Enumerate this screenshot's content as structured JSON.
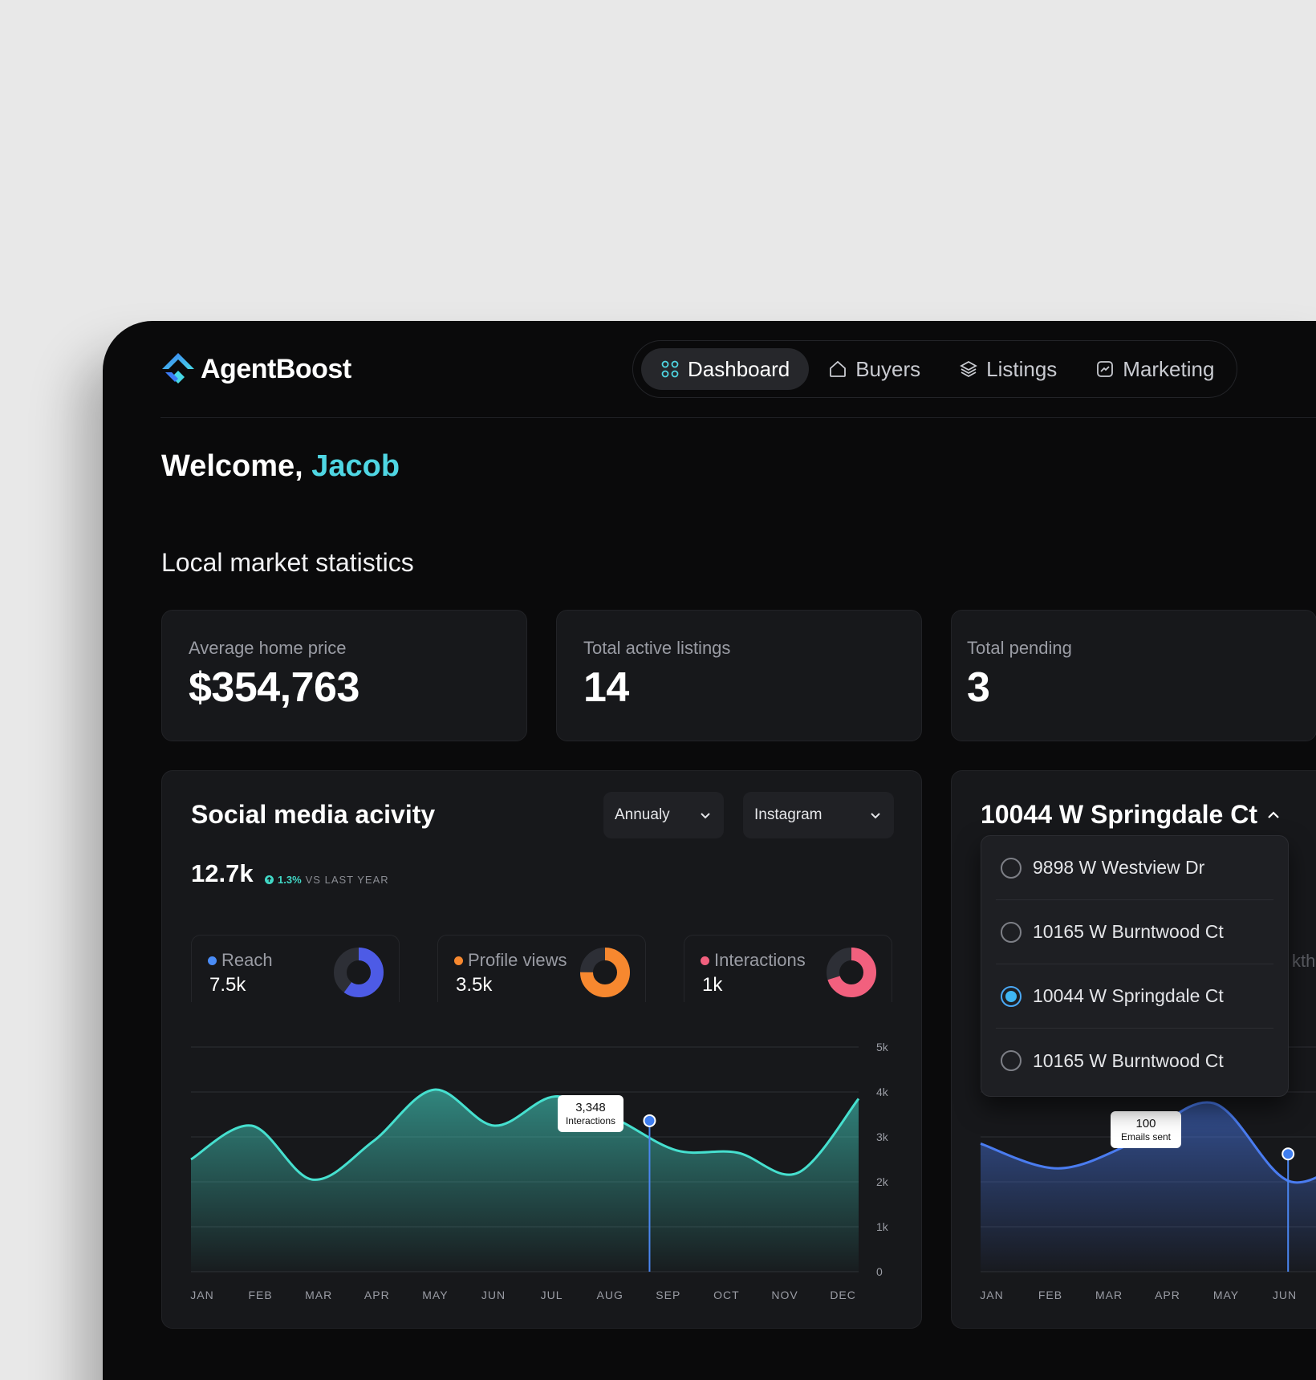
{
  "app": {
    "name": "AgentBoost",
    "accent": "#4fd6e3"
  },
  "nav": [
    {
      "label": "Dashboard",
      "icon": "grid-icon",
      "active": true
    },
    {
      "label": "Buyers",
      "icon": "home-icon",
      "active": false
    },
    {
      "label": "Listings",
      "icon": "layers-icon",
      "active": false
    },
    {
      "label": "Marketing",
      "icon": "trend-chart-icon",
      "active": false
    }
  ],
  "welcome": {
    "prefix": "Welcome, ",
    "name": "Jacob"
  },
  "section_title": "Local market statistics",
  "stats": [
    {
      "label": "Average home price",
      "value": "$354,763"
    },
    {
      "label": "Total active listings",
      "value": "14"
    },
    {
      "label": "Total pending",
      "value": "3"
    }
  ],
  "social": {
    "title": "Social media acivity",
    "period": "Annualy",
    "platform": "Instagram",
    "total": "12.7k",
    "delta": "1.3%",
    "delta_label": "VS LAST YEAR",
    "metrics": [
      {
        "label": "Reach",
        "value": "7.5k",
        "color": "#4a8cf7",
        "ring": "#4d5be6",
        "fraction": 0.6
      },
      {
        "label": "Profile views",
        "value": "3.5k",
        "color": "#f7882f",
        "ring": "#f7882f",
        "fraction": 0.75
      },
      {
        "label": "Interactions",
        "value": "1k",
        "color": "#f2607e",
        "ring": "#f2607e",
        "fraction": 0.7
      }
    ],
    "tooltip": {
      "value": "3,348",
      "label": "Interactions"
    }
  },
  "listing": {
    "title": "10044 W Springdale Ct",
    "options": [
      {
        "label": "9898 W Westview Dr",
        "selected": false
      },
      {
        "label": "10165 W Burntwood Ct",
        "selected": false
      },
      {
        "label": "10044 W Springdale Ct",
        "selected": true
      },
      {
        "label": "10165 W Burntwood Ct",
        "selected": false
      }
    ],
    "peek_text": "kthr",
    "tooltip": {
      "value": "100",
      "label": "Emails sent"
    }
  },
  "chart_data": [
    {
      "type": "area",
      "title": "Social media acivity",
      "categories": [
        "JAN",
        "FEB",
        "MAR",
        "APR",
        "MAY",
        "JUN",
        "JUL",
        "AUG",
        "SEP",
        "OCT",
        "NOV",
        "DEC"
      ],
      "yticks": [
        "0",
        "1k",
        "2k",
        "3k",
        "4k",
        "5k"
      ],
      "ylim": [
        0,
        5000
      ],
      "series": [
        {
          "name": "Interactions",
          "values": [
            2500,
            3250,
            2050,
            2900,
            4050,
            3250,
            3900,
            3400,
            2700,
            2650,
            2200,
            3850
          ]
        }
      ],
      "highlight": {
        "category": "AUG",
        "value": 3348
      },
      "color": "#46e0cf",
      "grid": true
    },
    {
      "type": "area",
      "title": "10044 W Springdale Ct",
      "categories": [
        "JAN",
        "FEB",
        "MAR",
        "APR",
        "MAY",
        "JUN"
      ],
      "ylim": [
        0,
        5000
      ],
      "series": [
        {
          "name": "Emails sent",
          "values": [
            2850,
            2300,
            2900,
            3750,
            2000,
            2900
          ]
        }
      ],
      "highlight": {
        "category": "MAY",
        "value": 100
      },
      "color": "#4a7cf0",
      "grid": true
    }
  ]
}
